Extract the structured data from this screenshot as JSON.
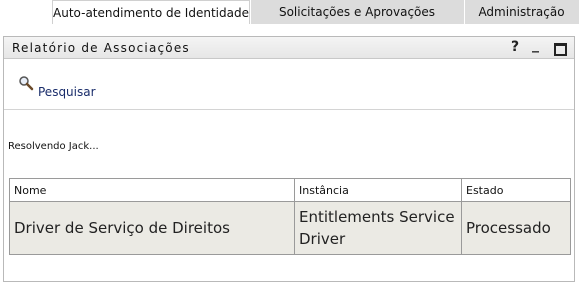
{
  "tabs": [
    {
      "label": "Auto-atendimento de Identidade",
      "active": true
    },
    {
      "label": "Solicitações e Aprovações",
      "active": false
    },
    {
      "label": "Administração",
      "active": false
    }
  ],
  "portlet": {
    "title": "Relatório de Associações",
    "help_icon": "?",
    "minimize_icon": "_",
    "maximize_icon": "□"
  },
  "search": {
    "label": "Pesquisar",
    "icon": "magnifier-icon"
  },
  "status_text": "Resolvendo Jack...",
  "table": {
    "columns": [
      "Nome",
      "Instância",
      "Estado"
    ],
    "rows": [
      [
        "Driver de Serviço de Direitos",
        "Entitlements Service Driver",
        "Processado"
      ]
    ]
  }
}
